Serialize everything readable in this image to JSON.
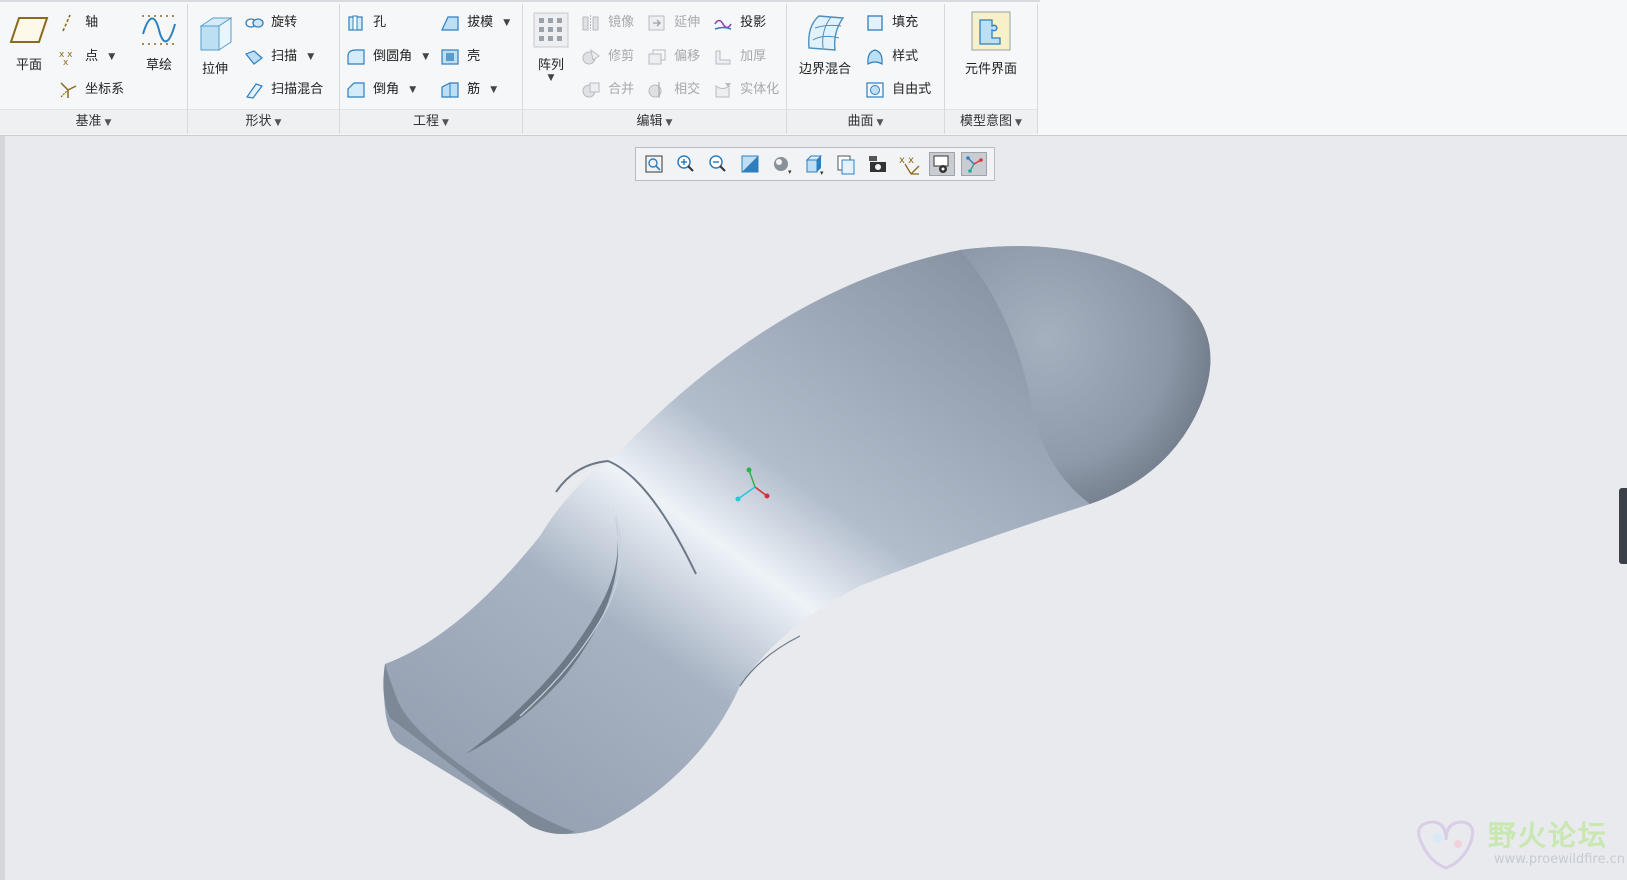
{
  "ribbon": {
    "groups": {
      "datum": {
        "footer": "基准",
        "plane": "平面",
        "axis": "轴",
        "point": "点",
        "csys": "坐标系",
        "sketch": "草绘"
      },
      "shapes": {
        "footer": "形状",
        "extrude": "拉伸",
        "revolve": "旋转",
        "sweep": "扫描",
        "swept_blend": "扫描混合"
      },
      "engineering": {
        "footer": "工程",
        "hole": "孔",
        "draft": "拔模",
        "round": "倒圆角",
        "shell": "壳",
        "chamfer": "倒角",
        "rib": "筋"
      },
      "editing": {
        "footer": "编辑",
        "pattern": "阵列",
        "mirror": "镜像",
        "extend": "延伸",
        "project": "投影",
        "trim": "修剪",
        "offset": "偏移",
        "thicken": "加厚",
        "merge": "合并",
        "intersect": "相交",
        "solidify": "实体化"
      },
      "surfaces": {
        "footer": "曲面",
        "boundary_blend": "边界混合",
        "fill": "填充",
        "style": "样式",
        "freestyle": "自由式"
      },
      "model_intent": {
        "footer": "模型意图",
        "component_interface": "元件界面"
      }
    }
  },
  "view_toolbar": {
    "icons": [
      "refit-icon",
      "zoom-in-icon",
      "zoom-out-icon",
      "repaint-icon",
      "display-style-icon",
      "saved-orientations-icon",
      "named-views-icon",
      "perspective-icon",
      "datum-display-icon",
      "annotation-display-icon",
      "spin-center-icon"
    ]
  },
  "colors": {
    "model": "#9aa6b6",
    "model_highlight": "#eef3f8",
    "model_shadow": "#6f7a88",
    "accent": "#2f7fbf"
  },
  "watermark": {
    "title": "野火论坛",
    "url": "www.proewildfire.cn"
  }
}
